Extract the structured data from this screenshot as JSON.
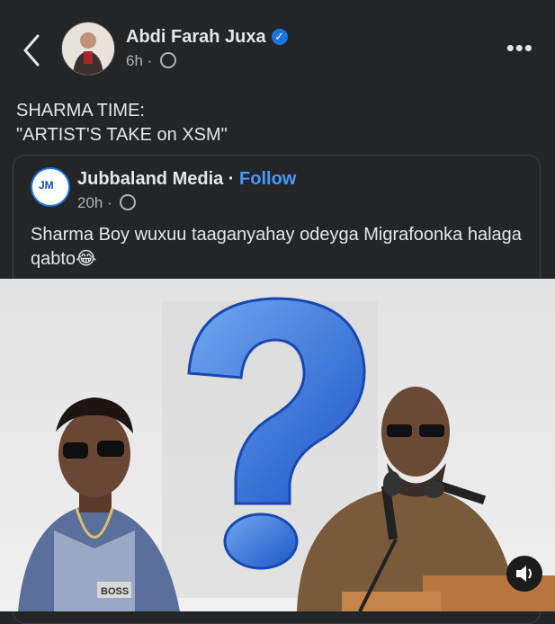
{
  "post": {
    "author": "Abdi Farah Juxa",
    "time": "6h",
    "text": "SHARMA TIME:\n\"ARTIST'S TAKE on XSM\""
  },
  "shared_post": {
    "page_name": "Jubbaland Media",
    "follow_label": "Follow",
    "time": "20h",
    "text": "Sharma Boy wuxuu taaganyahay odeyga Migrafoonka halaga qabto😂",
    "logo_text": "JM"
  },
  "image": {
    "chain_text": "BOSS"
  },
  "colors": {
    "background": "#242526",
    "accent": "#4599ff",
    "verified": "#1b74e4"
  },
  "icons": [
    "back-chevron-icon",
    "verified-badge-icon",
    "globe-icon",
    "more-options-icon",
    "sound-icon"
  ]
}
